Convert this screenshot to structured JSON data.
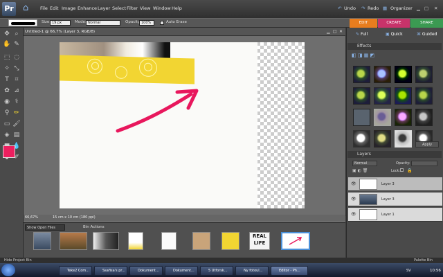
{
  "app": {
    "logo": "Pr"
  },
  "menu": [
    "File",
    "Edit",
    "Image",
    "Enhance",
    "Layer",
    "Select",
    "Filter",
    "View",
    "Window",
    "Help"
  ],
  "toolbar_right": {
    "undo": "Undo",
    "redo": "Redo",
    "organizer": "Organizer"
  },
  "options": {
    "size_label": "Size:",
    "size_value": "19 px",
    "mode_label": "Mode:",
    "mode_value": "Normal",
    "opacity_label": "Opacity:",
    "opacity_value": "100%",
    "auto_erase": "Auto Erase"
  },
  "tabs": {
    "edit": "EDIT",
    "create": "CREATE",
    "share": "SHARE"
  },
  "modes": {
    "full": "Full",
    "quick": "Quick",
    "guided": "Guided"
  },
  "document": {
    "title": "Untitled-1 @ 66,7% (Layer 3, RGB/8)",
    "zoom": "66,67%",
    "dims": "15 cm x 10 cm (180 ppi)"
  },
  "bin": {
    "show": "Show Open Files",
    "actions": "Bin Actions",
    "hide": "Hide Project Bin",
    "palette": "Palette Bin"
  },
  "effects": {
    "title": "Effects",
    "apply": "Apply"
  },
  "layers": {
    "title": "Layers",
    "blend": "Normal",
    "opacity_label": "Opacity:",
    "lock_label": "Lock:",
    "items": [
      {
        "name": "Layer 3"
      },
      {
        "name": "Layer 3"
      },
      {
        "name": "Layer 1"
      }
    ]
  },
  "taskbar": {
    "items": [
      "Teke2 Com...",
      "Ssafisa's pr...",
      "Dokument...",
      "Dokument...",
      "5 Utforsk...",
      "Ny fotoul...",
      "Editor - Ph..."
    ],
    "lang": "SV",
    "time": "10:56"
  },
  "colors": {
    "foreground": "#ec1f5f",
    "background": "#ffffff",
    "arrow": "#e8175d",
    "tape": "#f2d532"
  }
}
